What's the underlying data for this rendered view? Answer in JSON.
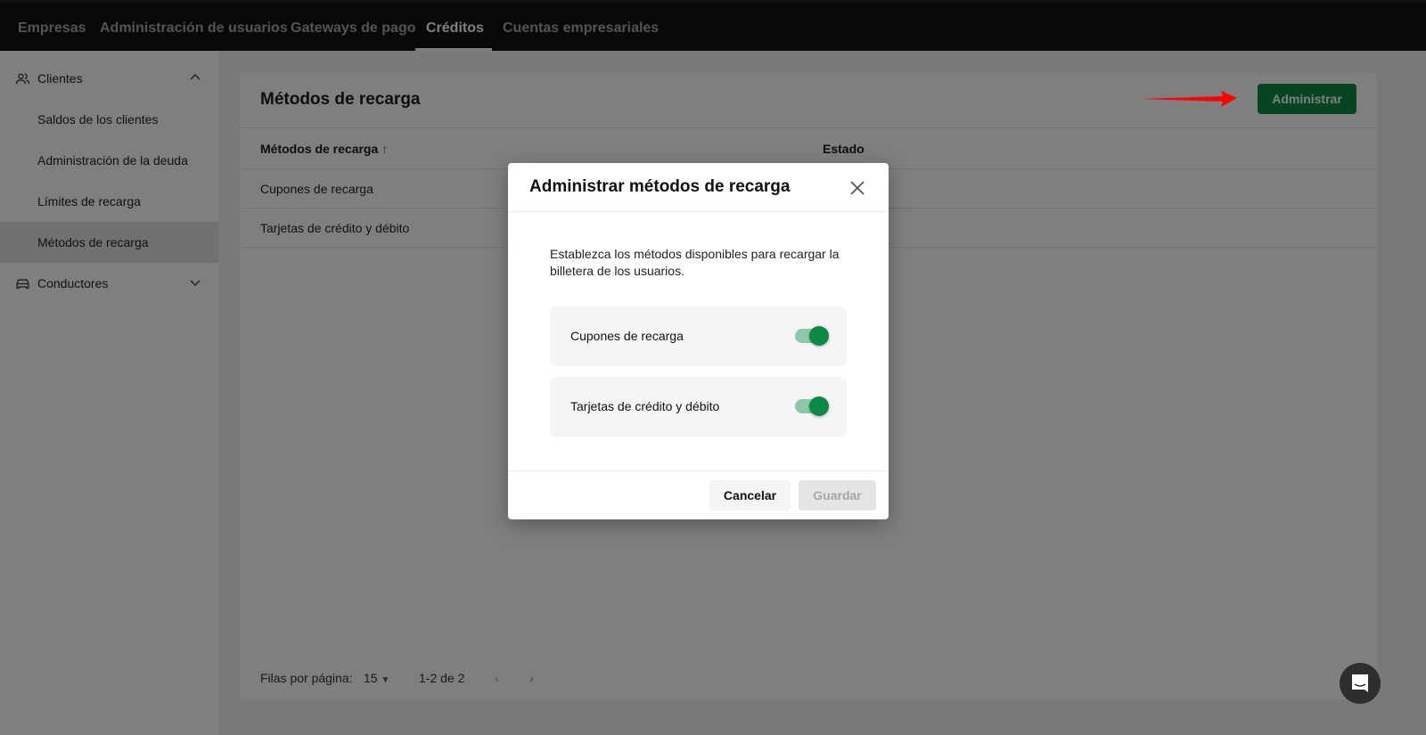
{
  "topnav": {
    "tabs": [
      {
        "label": "Empresas"
      },
      {
        "label": "Administración de usuarios"
      },
      {
        "label": "Gateways de pago"
      },
      {
        "label": "Créditos",
        "active": true
      },
      {
        "label": "Cuentas empresariales"
      }
    ]
  },
  "sidebar": {
    "groups": [
      {
        "label": "Clientes",
        "icon": "users-icon",
        "expanded": true,
        "items": [
          {
            "label": "Saldos de los clientes"
          },
          {
            "label": "Administración de la deuda"
          },
          {
            "label": "Límites de recarga"
          },
          {
            "label": "Métodos de recarga",
            "active": true
          }
        ]
      },
      {
        "label": "Conductores",
        "icon": "car-icon",
        "expanded": false
      }
    ]
  },
  "main": {
    "title": "Métodos de recarga",
    "admin_button": "Administrar",
    "columns": [
      "Métodos de recarga",
      "Estado"
    ],
    "sort_icon": "arrow-up-icon",
    "rows": [
      "Cupones de recarga",
      "Tarjetas de crédito y débito"
    ],
    "pagination": {
      "rows_per_page_label": "Filas por página:",
      "rows_per_page": "15",
      "range": "1-2 de 2"
    }
  },
  "modal": {
    "title": "Administrar métodos de recarga",
    "description": "Establezca los métodos disponibles para recargar la billetera de los usuarios.",
    "options": [
      {
        "label": "Cupones de recarga",
        "enabled": true
      },
      {
        "label": "Tarjetas de crédito y débito",
        "enabled": true
      }
    ],
    "cancel": "Cancelar",
    "save": "Guardar"
  },
  "colors": {
    "accent": "#0a8a45",
    "nav_bg": "#111113",
    "annotation_arrow": "#ff0000"
  }
}
